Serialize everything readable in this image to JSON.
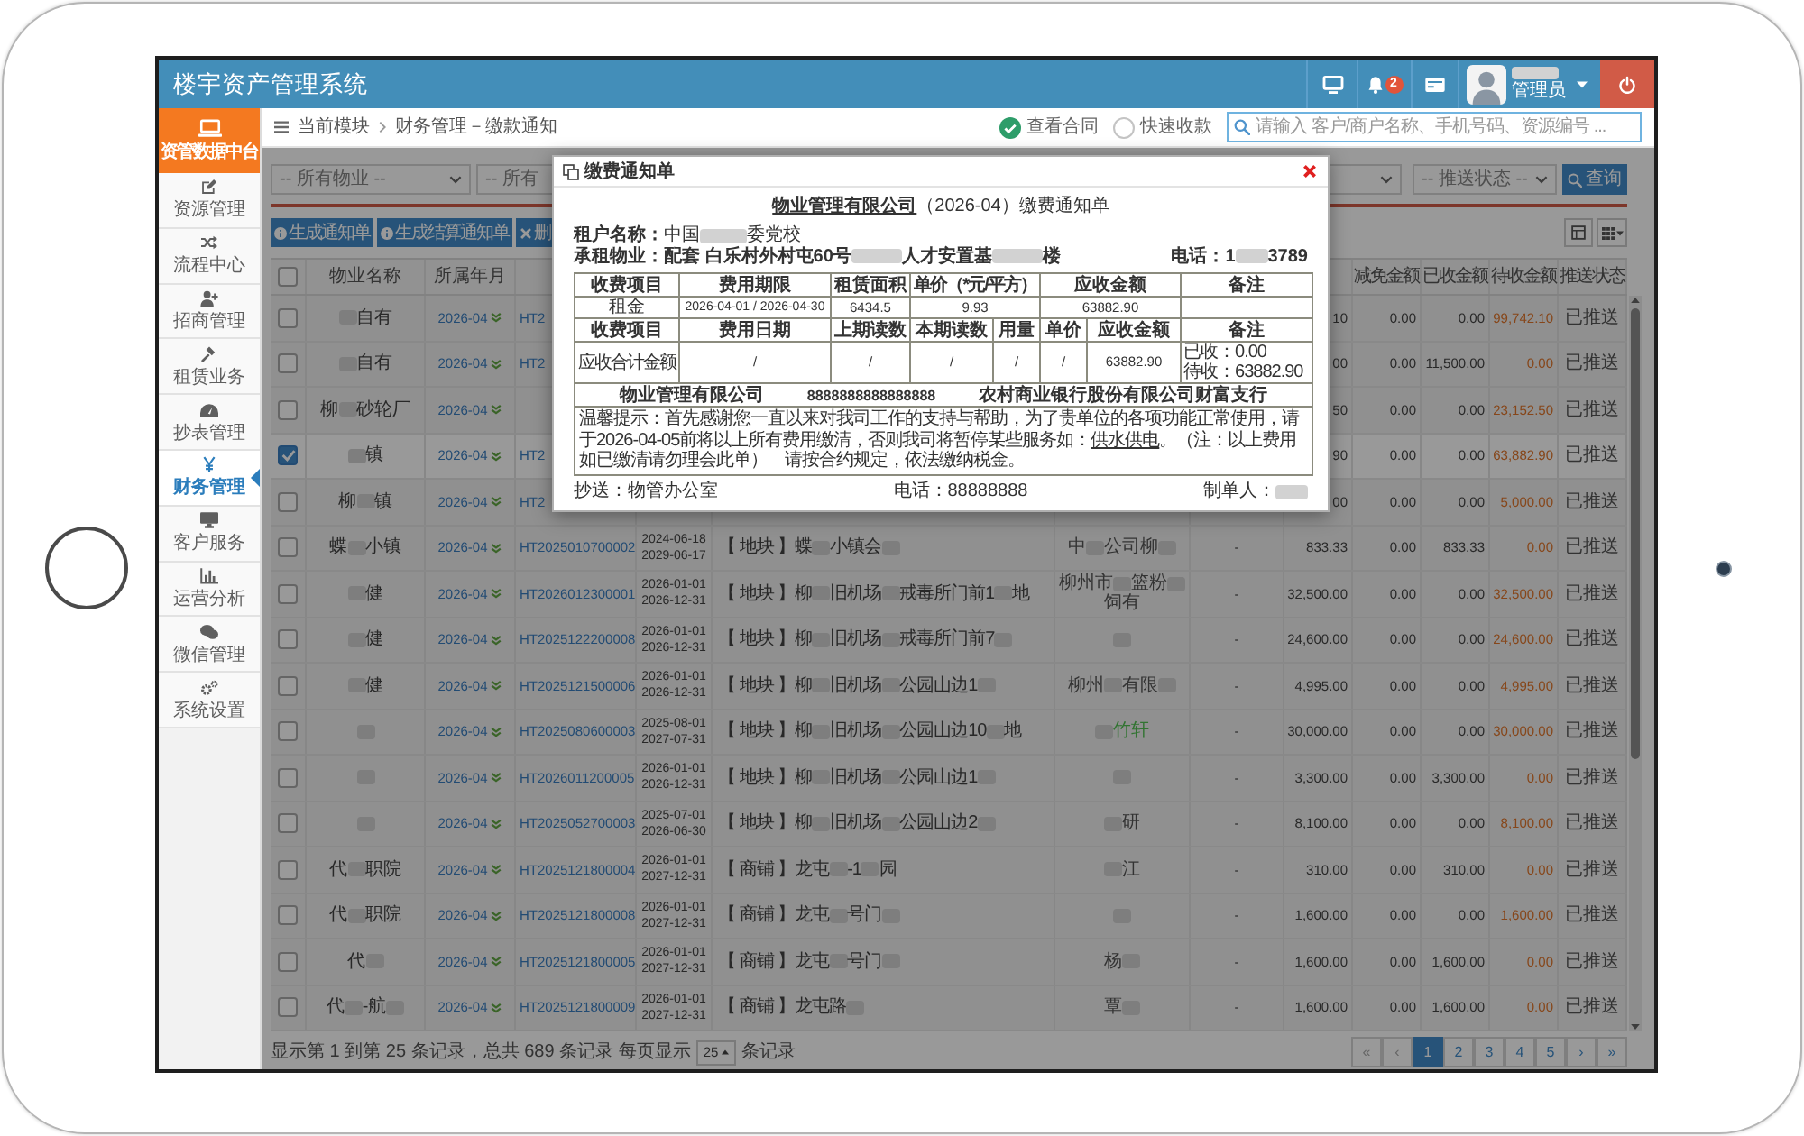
{
  "topbar": {
    "title": "楼宇资产管理系统",
    "notification_count": "2",
    "user_name": [
      {
        "kind": "redacted"
      }
    ],
    "user_role": "管理员"
  },
  "sidebar": {
    "brand": "资管数据中台",
    "items": [
      {
        "label": "资源管理",
        "selected": false
      },
      {
        "label": "流程中心",
        "selected": false
      },
      {
        "label": "招商管理",
        "selected": false
      },
      {
        "label": "租赁业务",
        "selected": false
      },
      {
        "label": "抄表管理",
        "selected": false
      },
      {
        "label": "财务管理",
        "selected": true
      },
      {
        "label": "客户服务",
        "selected": false
      },
      {
        "label": "运营分析",
        "selected": false
      },
      {
        "label": "微信管理",
        "selected": false
      },
      {
        "label": "系统设置",
        "selected": false
      }
    ]
  },
  "breadcrumb": {
    "module": "当前模块",
    "current": "财务管理－缴款通知",
    "toggles": [
      {
        "label": "查看合同",
        "checked": true
      },
      {
        "label": "快速收款",
        "checked": false
      }
    ],
    "search_placeholder": "请输入 客户/商户名称、手机号码、资源编号 ..."
  },
  "filters": {
    "property_select": "-- 所有物业 --",
    "building_select": "-- 所有",
    "push_status_select": "-- 推送状态 --",
    "query_button": "查询"
  },
  "actions": [
    "生成通知单",
    "生成结算通知单",
    "删"
  ],
  "table": {
    "header_checked": false,
    "headers": {
      "property": "物业名称",
      "month": "所属年月",
      "reduction": "减免金额",
      "received": "已收金额",
      "pending": "待收金额",
      "push_status": "推送状态"
    },
    "rows": [
      {
        "checked": false,
        "property": [
          {
            "kind": "redacted"
          },
          {
            "kind": "text",
            "text": "自有"
          }
        ],
        "month": "2026-04",
        "column_4": "HT2",
        "column_9": "10",
        "reduction": "0.00",
        "received": "0.00",
        "pending": "99,742.10",
        "push_status": "已推送"
      },
      {
        "checked": false,
        "property": [
          {
            "kind": "redacted"
          },
          {
            "kind": "text",
            "text": "自有"
          }
        ],
        "month": "2026-04",
        "column_4": "HT2",
        "column_9": "00",
        "reduction": "0.00",
        "received": "11,500.00",
        "pending": "0.00",
        "push_status": "已推送"
      },
      {
        "checked": false,
        "property": [
          {
            "kind": "text",
            "text": "柳"
          },
          {
            "kind": "redacted"
          },
          {
            "kind": "text",
            "text": "砂轮厂"
          }
        ],
        "month": "2026-04",
        "column_9": "50",
        "reduction": "0.00",
        "received": "0.00",
        "pending": "23,152.50",
        "push_status": "已推送"
      },
      {
        "checked": true,
        "property": [
          {
            "kind": "redacted"
          },
          {
            "kind": "text",
            "text": "镇"
          }
        ],
        "month": "2026-04",
        "column_4": "HT2",
        "column_9": "90",
        "reduction": "0.00",
        "received": "0.00",
        "pending": "63,882.90",
        "push_status": "已推送"
      },
      {
        "checked": false,
        "property": [
          {
            "kind": "text",
            "text": "柳"
          },
          {
            "kind": "redacted"
          },
          {
            "kind": "text",
            "text": "镇"
          }
        ],
        "month": "2026-04",
        "column_4": "HT2",
        "column_9": "00",
        "reduction": "0.00",
        "received": "0.00",
        "pending": "5,000.00",
        "push_status": "已推送"
      },
      {
        "checked": false,
        "property": [
          {
            "kind": "text",
            "text": "蝶"
          },
          {
            "kind": "redacted"
          },
          {
            "kind": "text",
            "text": "小镇"
          }
        ],
        "month": "2026-04",
        "column_4": "HT2025010700002",
        "column_5": [
          "2024-06-18",
          "2029-06-17"
        ],
        "column_6": [
          {
            "kind": "text",
            "text": "【 地块 】蝶"
          },
          {
            "kind": "redacted"
          },
          {
            "kind": "text",
            "text": "小镇会"
          },
          {
            "kind": "redacted"
          }
        ],
        "column_7": {
          "parts": [
            {
              "kind": "text",
              "text": "中"
            },
            {
              "kind": "redacted"
            },
            {
              "kind": "text",
              "text": "公司柳"
            },
            {
              "kind": "redacted"
            }
          ],
          "highlighted": false
        },
        "column_8": "-",
        "column_9": "833.33",
        "reduction": "0.00",
        "received": "833.33",
        "pending": "0.00",
        "push_status": "已推送"
      },
      {
        "checked": false,
        "property": [
          {
            "kind": "redacted"
          },
          {
            "kind": "text",
            "text": "健"
          }
        ],
        "month": "2026-04",
        "column_4": "HT2026012300001",
        "column_5": [
          "2026-01-01",
          "2026-12-31"
        ],
        "column_6": [
          {
            "kind": "text",
            "text": "【 地块 】柳"
          },
          {
            "kind": "redacted"
          },
          {
            "kind": "text",
            "text": "旧机场"
          },
          {
            "kind": "redacted"
          },
          {
            "kind": "text",
            "text": "戒毒所门前1"
          },
          {
            "kind": "redacted"
          },
          {
            "kind": "text",
            "text": "地"
          }
        ],
        "column_7": {
          "parts": [
            {
              "kind": "text",
              "text": "柳州市"
            },
            {
              "kind": "redacted"
            },
            {
              "kind": "text",
              "text": "篮粉"
            },
            {
              "kind": "redacted"
            },
            {
              "kind": "text",
              "text": "饲有"
            }
          ],
          "highlighted": false
        },
        "column_8": "-",
        "column_9": "32,500.00",
        "reduction": "0.00",
        "received": "0.00",
        "pending": "32,500.00",
        "push_status": "已推送"
      },
      {
        "checked": false,
        "property": [
          {
            "kind": "redacted"
          },
          {
            "kind": "text",
            "text": "健"
          }
        ],
        "month": "2026-04",
        "column_4": "HT2025122200008",
        "column_5": [
          "2026-01-01",
          "2026-12-31"
        ],
        "column_6": [
          {
            "kind": "text",
            "text": "【 地块 】柳"
          },
          {
            "kind": "redacted"
          },
          {
            "kind": "text",
            "text": "旧机场"
          },
          {
            "kind": "redacted"
          },
          {
            "kind": "text",
            "text": "戒毒所门前7"
          },
          {
            "kind": "redacted"
          }
        ],
        "column_7": {
          "parts": [
            {
              "kind": "redacted"
            }
          ]
        },
        "column_8": "-",
        "column_9": "24,600.00",
        "reduction": "0.00",
        "received": "0.00",
        "pending": "24,600.00",
        "push_status": "已推送"
      },
      {
        "checked": false,
        "property": [
          {
            "kind": "redacted"
          },
          {
            "kind": "text",
            "text": "健"
          }
        ],
        "month": "2026-04",
        "column_4": "HT2025121500006",
        "column_5": [
          "2026-01-01",
          "2026-12-31"
        ],
        "column_6": [
          {
            "kind": "text",
            "text": "【 地块 】柳"
          },
          {
            "kind": "redacted"
          },
          {
            "kind": "text",
            "text": "旧机场"
          },
          {
            "kind": "redacted"
          },
          {
            "kind": "text",
            "text": "公园山边1"
          },
          {
            "kind": "redacted"
          }
        ],
        "column_7": {
          "parts": [
            {
              "kind": "text",
              "text": "柳州"
            },
            {
              "kind": "redacted"
            },
            {
              "kind": "text",
              "text": "有限"
            },
            {
              "kind": "redacted"
            }
          ],
          "highlighted": false
        },
        "column_8": "-",
        "column_9": "4,995.00",
        "reduction": "0.00",
        "received": "0.00",
        "pending": "4,995.00",
        "push_status": "已推送"
      },
      {
        "checked": false,
        "property": [
          {
            "kind": "redacted"
          }
        ],
        "month": "2026-04",
        "column_4": "HT2025080600003",
        "column_5": [
          "2025-08-01",
          "2027-07-31"
        ],
        "column_6": [
          {
            "kind": "text",
            "text": "【 地块 】柳"
          },
          {
            "kind": "redacted"
          },
          {
            "kind": "text",
            "text": "旧机场"
          },
          {
            "kind": "redacted"
          },
          {
            "kind": "text",
            "text": "公园山边10"
          },
          {
            "kind": "redacted"
          },
          {
            "kind": "text",
            "text": "地"
          }
        ],
        "column_7": {
          "parts": [
            {
              "kind": "redacted"
            },
            {
              "kind": "text",
              "text": "竹轩"
            }
          ],
          "highlighted": true
        },
        "column_8": "-",
        "column_9": "30,000.00",
        "reduction": "0.00",
        "received": "0.00",
        "pending": "30,000.00",
        "push_status": "已推送"
      },
      {
        "checked": false,
        "property": [
          {
            "kind": "redacted"
          }
        ],
        "month": "2026-04",
        "column_4": "HT2026011200005",
        "column_5": [
          "2026-01-01",
          "2026-12-31"
        ],
        "column_6": [
          {
            "kind": "text",
            "text": "【 地块 】柳"
          },
          {
            "kind": "redacted"
          },
          {
            "kind": "text",
            "text": "旧机场"
          },
          {
            "kind": "redacted"
          },
          {
            "kind": "text",
            "text": "公园山边1"
          },
          {
            "kind": "redacted"
          }
        ],
        "column_7": {
          "parts": [
            {
              "kind": "redacted"
            }
          ]
        },
        "column_8": "-",
        "column_9": "3,300.00",
        "reduction": "0.00",
        "received": "3,300.00",
        "pending": "0.00",
        "push_status": "已推送"
      },
      {
        "checked": false,
        "property": [
          {
            "kind": "redacted"
          }
        ],
        "month": "2026-04",
        "column_4": "HT2025052700003",
        "column_5": [
          "2025-07-01",
          "2026-06-30"
        ],
        "column_6": [
          {
            "kind": "text",
            "text": "【 地块 】柳"
          },
          {
            "kind": "redacted"
          },
          {
            "kind": "text",
            "text": "旧机场"
          },
          {
            "kind": "redacted"
          },
          {
            "kind": "text",
            "text": "公园山边2"
          },
          {
            "kind": "redacted"
          }
        ],
        "column_7": {
          "parts": [
            {
              "kind": "redacted"
            },
            {
              "kind": "text",
              "text": "研"
            }
          ],
          "highlighted": false
        },
        "column_8": "-",
        "column_9": "8,100.00",
        "reduction": "0.00",
        "received": "0.00",
        "pending": "8,100.00",
        "push_status": "已推送"
      },
      {
        "checked": false,
        "property": [
          {
            "kind": "text",
            "text": "代"
          },
          {
            "kind": "redacted"
          },
          {
            "kind": "text",
            "text": "职院"
          }
        ],
        "month": "2026-04",
        "column_4": "HT2025121800004",
        "column_5": [
          "2026-01-01",
          "2027-12-31"
        ],
        "column_6": [
          {
            "kind": "text",
            "text": "【 商铺 】龙屯"
          },
          {
            "kind": "redacted"
          },
          {
            "kind": "text",
            "text": "-1"
          },
          {
            "kind": "redacted"
          },
          {
            "kind": "text",
            "text": "园"
          }
        ],
        "column_7": {
          "parts": [
            {
              "kind": "redacted"
            },
            {
              "kind": "text",
              "text": "江"
            }
          ],
          "highlighted": false
        },
        "column_8": "-",
        "column_9": "310.00",
        "reduction": "0.00",
        "received": "310.00",
        "pending": "0.00",
        "push_status": "已推送"
      },
      {
        "checked": false,
        "property": [
          {
            "kind": "text",
            "text": "代"
          },
          {
            "kind": "redacted"
          },
          {
            "kind": "text",
            "text": "职院"
          }
        ],
        "month": "2026-04",
        "column_4": "HT2025121800008",
        "column_5": [
          "2026-01-01",
          "2027-12-31"
        ],
        "column_6": [
          {
            "kind": "text",
            "text": "【 商铺 】龙屯"
          },
          {
            "kind": "redacted"
          },
          {
            "kind": "text",
            "text": "号门"
          },
          {
            "kind": "redacted"
          }
        ],
        "column_7": {
          "parts": [
            {
              "kind": "redacted"
            }
          ]
        },
        "column_8": "-",
        "column_9": "1,600.00",
        "reduction": "0.00",
        "received": "0.00",
        "pending": "1,600.00",
        "push_status": "已推送"
      },
      {
        "checked": false,
        "property": [
          {
            "kind": "text",
            "text": "代"
          },
          {
            "kind": "redacted"
          }
        ],
        "month": "2026-04",
        "column_4": "HT2025121800005",
        "column_5": [
          "2026-01-01",
          "2027-12-31"
        ],
        "column_6": [
          {
            "kind": "text",
            "text": "【 商铺 】龙屯"
          },
          {
            "kind": "redacted"
          },
          {
            "kind": "text",
            "text": "号门"
          },
          {
            "kind": "redacted"
          }
        ],
        "column_7": {
          "parts": [
            {
              "kind": "text",
              "text": "杨"
            },
            {
              "kind": "redacted"
            }
          ],
          "highlighted": false
        },
        "column_8": "-",
        "column_9": "1,600.00",
        "reduction": "0.00",
        "received": "1,600.00",
        "pending": "0.00",
        "push_status": "已推送"
      },
      {
        "checked": false,
        "property": [
          {
            "kind": "text",
            "text": "代"
          },
          {
            "kind": "redacted"
          },
          {
            "kind": "text",
            "text": "-航"
          },
          {
            "kind": "redacted"
          }
        ],
        "month": "2026-04",
        "column_4": "HT2025121800009",
        "column_5": [
          "2026-01-01",
          "2027-12-31"
        ],
        "column_6": [
          {
            "kind": "text",
            "text": "【 商铺 】龙屯路"
          },
          {
            "kind": "redacted"
          }
        ],
        "column_7": {
          "parts": [
            {
              "kind": "text",
              "text": "覃"
            },
            {
              "kind": "redacted"
            }
          ],
          "highlighted": false
        },
        "column_8": "-",
        "column_9": "1,600.00",
        "reduction": "0.00",
        "received": "1,600.00",
        "pending": "0.00",
        "push_status": "已推送"
      }
    ]
  },
  "footer": {
    "summary": "显示第 1 到第 25 条记录，总共 689 条记录 每页显示",
    "page_size": "25",
    "suffix": "条记录",
    "pages": [
      {
        "label": "«",
        "selected": false,
        "disabled": true
      },
      {
        "label": "‹",
        "selected": false,
        "disabled": true
      },
      {
        "label": "1",
        "selected": true,
        "disabled": false
      },
      {
        "label": "2",
        "selected": false,
        "disabled": false
      },
      {
        "label": "3",
        "selected": false,
        "disabled": false
      },
      {
        "label": "4",
        "selected": false,
        "disabled": false
      },
      {
        "label": "5",
        "selected": false,
        "disabled": false
      },
      {
        "label": "›",
        "selected": false,
        "disabled": false
      },
      {
        "label": "»",
        "selected": false,
        "disabled": false
      }
    ]
  },
  "modal": {
    "title": "缴费通知单",
    "company": "物业管理有限公司",
    "heading": "（2026-04）缴费通知单",
    "tenant_label": "租户名称：",
    "tenant": [
      {
        "kind": "text",
        "text": "中国"
      },
      {
        "kind": "redacted"
      },
      {
        "kind": "text",
        "text": "委党校"
      }
    ],
    "property_label": "承租物业：",
    "property": [
      {
        "kind": "text",
        "text": "配套 白乐村外村屯60号"
      },
      {
        "kind": "redacted"
      },
      {
        "kind": "text",
        "text": "人才安置基"
      },
      {
        "kind": "redacted"
      },
      {
        "kind": "text",
        "text": "楼"
      }
    ],
    "phone_label": "电话：",
    "phone": [
      {
        "kind": "text",
        "text": "1"
      },
      {
        "kind": "redacted"
      },
      {
        "kind": "text",
        "text": "3789"
      }
    ],
    "rent_table": {
      "headers": [
        "收费项目",
        "费用期限",
        "租赁面积",
        "单价（*元/平方）",
        "应收金额",
        "备注"
      ],
      "row": [
        "租金",
        "2026-04-01 / 2026-04-30",
        "6434.5",
        "9.93",
        "63882.90"
      ]
    },
    "meter_table": {
      "headers": [
        "收费项目",
        "费用日期",
        "上期读数",
        "本期读数",
        "用量",
        "单价",
        "应收金额",
        "备注"
      ],
      "row": [
        "应收合计金额",
        "/",
        "/",
        "/",
        "/",
        "/",
        "63882.90"
      ],
      "remarks": [
        "已收：0.00",
        "待收：63882.90"
      ]
    },
    "bank_row": [
      "物业管理有限公司",
      "8888888888888888",
      "农村商业银行股份有限公司财富支行"
    ],
    "reminder": [
      {
        "kind": "text",
        "text": "温馨提示：首先感谢您一直以来对我司工作的支持与帮助，为了贵单位的各项功能正常使用，请于2026-04-05前将以上所有费用缴清，否则我司将暂停某些服务如："
      },
      {
        "kind": "link",
        "text": "供水供电"
      },
      {
        "kind": "text",
        "text": "。（注：以上费用如已缴清请勿理会此单）　请按合约规定，依法缴纳税金。"
      }
    ],
    "cc": "抄送：物管办公室",
    "contact": "电话：88888888",
    "maker_label": "制单人：",
    "maker": [
      {
        "kind": "redacted"
      }
    ]
  }
}
